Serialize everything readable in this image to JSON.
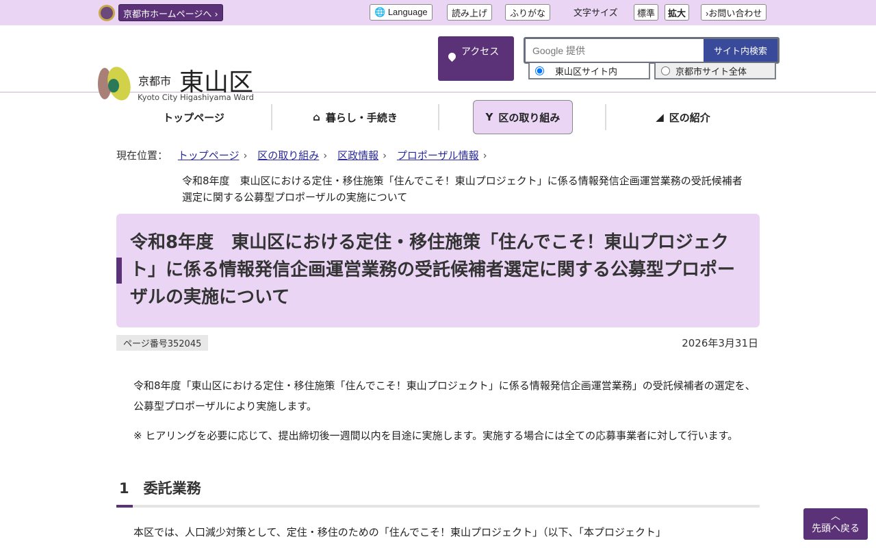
{
  "topbar": {
    "kyoto_home": "京都市ホームページへ ›",
    "language": "Language",
    "read_aloud": "読み上げ",
    "furigana": "ふりがな",
    "font_size_label": "文字サイズ",
    "font_standard": "標準",
    "font_large": "拡大",
    "contact": "›お問い合わせ"
  },
  "header": {
    "logo_city": "京都市",
    "logo_ward": "東山区",
    "logo_en": "Kyoto City Higashiyama Ward",
    "access": "アクセス",
    "search_placeholder": "Google 提供",
    "search_button": "サイト内検索",
    "radio_ward": "東山区サイト内",
    "radio_city": "京都市サイト全体"
  },
  "nav": {
    "items": [
      {
        "label": "トップページ"
      },
      {
        "label": "暮らし・手続き"
      },
      {
        "label": "区の取り組み"
      },
      {
        "label": "区の紹介"
      }
    ]
  },
  "breadcrumb": {
    "label": "現在位置：",
    "items": [
      "トップページ",
      "区の取り組み",
      "区政情報",
      "プロポーザル情報"
    ],
    "current": "令和8年度　東山区における定住・移住施策「住んでこそ！東山プロジェクト」に係る情報発信企画運営業務の受託候補者選定に関する公募型プロポーザルの実施について"
  },
  "page": {
    "title": "令和8年度　東山区における定住・移住施策「住んでこそ！東山プロジェクト」に係る情報発信企画運営業務の受託候補者選定に関する公募型プロポーザルの実施について",
    "page_number": "ページ番号352045",
    "date": "2026年3月31日",
    "para1": "令和8年度「東山区における定住・移住施策「住んでこそ！東山プロジェクト」に係る情報発信企画運営業務」の受託候補者の選定を、公募型プロポーザルにより実施します。",
    "para2": "※ ヒアリングを必要に応じて、提出締切後一週間以内を目途に実施します。実施する場合には全ての応募事業者に対して行います。",
    "section1": "1　委託業務",
    "para3": "本区では、人口減少対策として、定住・移住のための「住んでこそ！東山プロジェクト」（以下、「本プロジェクト」"
  },
  "back_to_top": "先頭へ戻る"
}
